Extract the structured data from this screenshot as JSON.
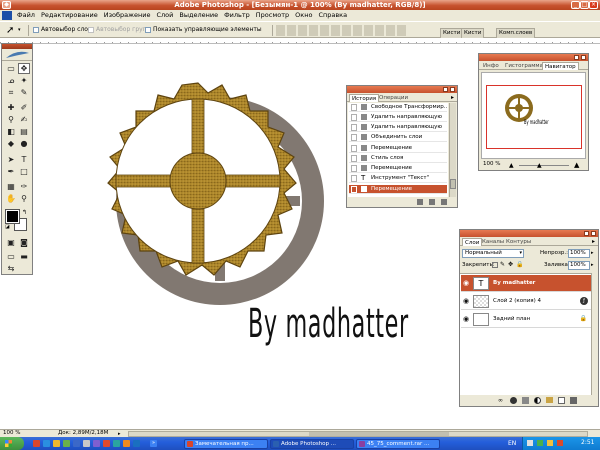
{
  "window": {
    "title": "Adobe Photoshop - [Безымян-1 @ 100% (By madhatter, RGB/8)]",
    "title_tab_text": "Adobe Photoshop"
  },
  "menu": {
    "items": [
      "Файл",
      "Редактирование",
      "Изображение",
      "Слой",
      "Выделение",
      "Фильтр",
      "Просмотр",
      "Окно",
      "Справка"
    ]
  },
  "options_bar": {
    "auto_select_layer": "Автовыбор слоя",
    "auto_select_groups": "Автовыбор групп",
    "show_transform_controls": "Показать управляющие элементы",
    "bin_tabs": [
      "Кисти",
      "Кисти",
      "Комп.слоев"
    ]
  },
  "canvas": {
    "signature_text": "By madhatter"
  },
  "navigator": {
    "tabs": [
      "Инфо",
      "Гистограмма",
      "Навигатор"
    ],
    "zoom": "100 %",
    "thumb_text": "By madhatter"
  },
  "history": {
    "tabs": [
      "История",
      "Операции"
    ],
    "items": [
      "Свободное Трансформир...",
      "Удалить направляющую",
      "Удалить направляющую",
      "Объединить слои",
      "Перемещение",
      "Стиль слоя",
      "Перемещение",
      "Инструмент \"Текст\"",
      "Перемещение"
    ],
    "selected_index": 8
  },
  "layers": {
    "tabs": [
      "Слои",
      "Каналы",
      "Контуры"
    ],
    "blend_mode": "Нормальный",
    "opacity_label": "Непрозр.:",
    "opacity": "100%",
    "lock_label": "Закрепить:",
    "fill_label": "Заливка:",
    "fill": "100%",
    "items": [
      {
        "name": "By madhatter",
        "thumb": "T",
        "selected": true
      },
      {
        "name": "Слой 2 (копия) 4",
        "thumb": "",
        "selected": false
      },
      {
        "name": "Задний план",
        "thumb": "",
        "selected": false
      }
    ]
  },
  "status_bar": {
    "zoom": "100 %",
    "doc_info": "Док: 2,89M/2,18M"
  },
  "taskbar": {
    "buttons": [
      "Замечательная пр...",
      "Adobe Photoshop ...",
      "45_75_comment.rar ..."
    ],
    "tray_lang": "EN",
    "clock": "2:51"
  },
  "colors": {
    "accent": "#c7522e",
    "panel_bg": "#ece9d8",
    "gold": "#b8912e",
    "taskbar": "#245edb"
  }
}
